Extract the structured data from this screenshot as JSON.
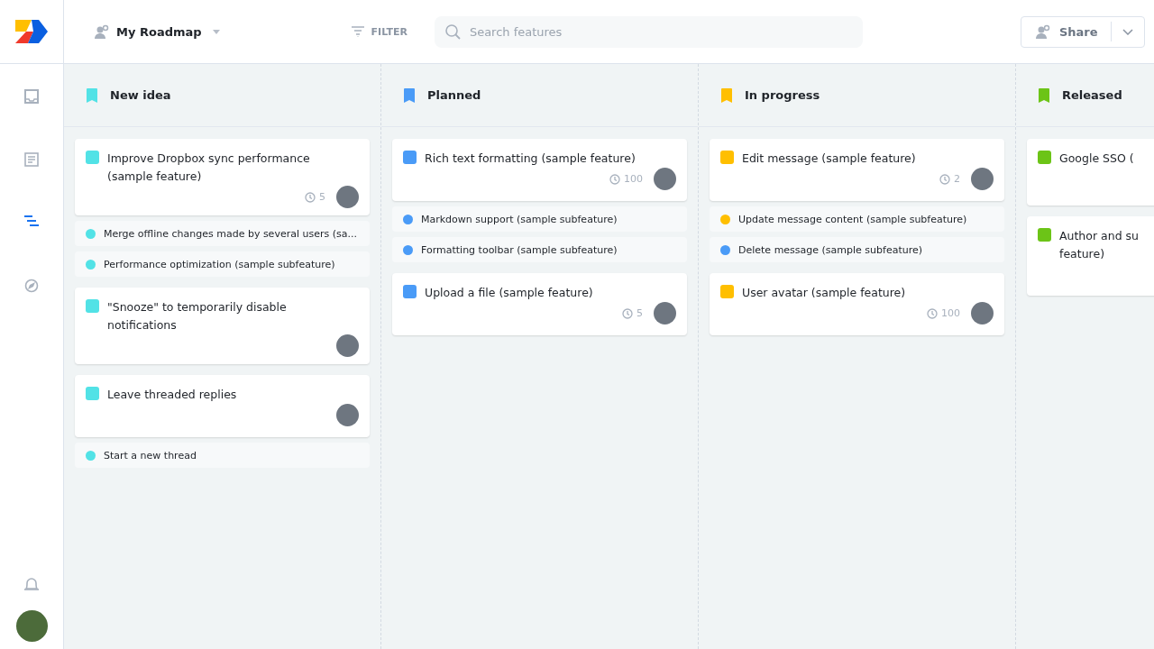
{
  "header": {
    "roadmap_name": "My Roadmap",
    "filter_label": "FILTER",
    "search": {
      "placeholder": "Search features"
    },
    "share_label": "Share"
  },
  "sidebar": {
    "items": [
      {
        "kind": "inbox",
        "selected": false
      },
      {
        "kind": "document",
        "selected": false
      },
      {
        "kind": "roadmap",
        "selected": true
      },
      {
        "kind": "compass",
        "selected": false
      }
    ]
  },
  "columns": [
    {
      "title": "New idea",
      "color": "#52e2e6",
      "cards": [
        {
          "title": "Improve Dropbox sync performance (sample feature)",
          "color": "#52e2e6",
          "estimate": "5",
          "avatar": true,
          "subfeatures": [
            {
              "title": "Merge offline changes made by several users (sa...",
              "color": "#52e2e6"
            },
            {
              "title": "Performance optimization (sample subfeature)",
              "color": "#52e2e6"
            }
          ]
        },
        {
          "title": "\"Snooze\" to temporarily disable notifications",
          "color": "#52e2e6",
          "avatar": true
        },
        {
          "title": "Leave threaded replies",
          "color": "#52e2e6",
          "avatar": true,
          "subfeatures": [
            {
              "title": "Start a new thread",
              "color": "#52e2e6"
            }
          ]
        }
      ]
    },
    {
      "title": "Planned",
      "color": "#4a9bf7",
      "cards": [
        {
          "title": "Rich text formatting (sample feature)",
          "color": "#4a9bf7",
          "estimate": "100",
          "avatar": true,
          "subfeatures": [
            {
              "title": "Markdown support (sample subfeature)",
              "color": "#4a9bf7"
            },
            {
              "title": "Formatting toolbar (sample subfeature)",
              "color": "#4a9bf7"
            }
          ]
        },
        {
          "title": "Upload a file (sample feature)",
          "color": "#4a9bf7",
          "estimate": "5",
          "avatar": true
        }
      ]
    },
    {
      "title": "In progress",
      "color": "#ffbf00",
      "cards": [
        {
          "title": "Edit message (sample feature)",
          "color": "#ffbf00",
          "estimate": "2",
          "avatar": true,
          "subfeatures": [
            {
              "title": "Update message content (sample subfeature)",
              "color": "#ffbf00"
            },
            {
              "title": "Delete message (sample subfeature)",
              "color": "#4a9bf7"
            }
          ]
        },
        {
          "title": "User avatar (sample feature)",
          "color": "#ffbf00",
          "estimate": "100",
          "avatar": true
        }
      ]
    },
    {
      "title": "Released",
      "color": "#6cc417",
      "cards": [
        {
          "title": "Google SSO (",
          "color": "#6cc417"
        },
        {
          "title": "Author and su\nfeature)",
          "color": "#6cc417"
        }
      ]
    }
  ]
}
